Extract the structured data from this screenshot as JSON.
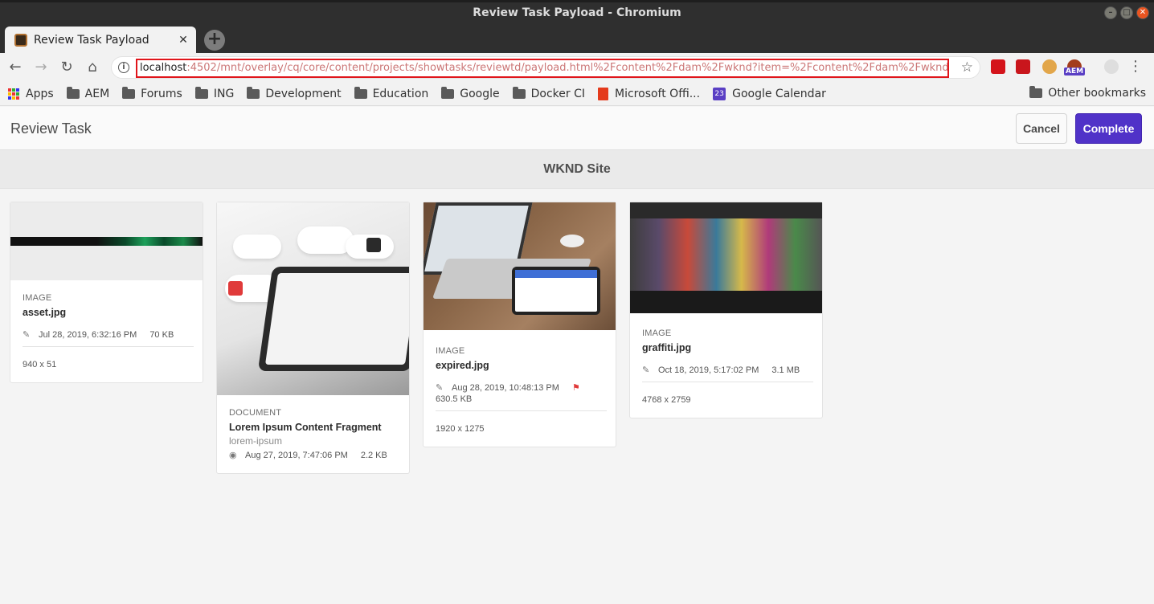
{
  "window": {
    "title": "Review Task Payload - Chromium"
  },
  "tab": {
    "title": "Review Task Payload",
    "close": "✕",
    "new_tab": "+"
  },
  "toolbar": {
    "url_host": "localhost",
    "url_rest": ":4502/mnt/overlay/cq/core/content/projects/showtasks/reviewtd/payload.html%2Fcontent%2Fdam%2Fwknd?item=%2Fcontent%2Fdam%2Fwknd%...",
    "info": "i",
    "star": "☆",
    "aem_badge": "AEM",
    "menu": "⋮"
  },
  "bookmarks": {
    "apps": "Apps",
    "items": [
      "AEM",
      "Forums",
      "ING",
      "Development",
      "Education",
      "Google",
      "Docker CI"
    ],
    "microsoft": "Microsoft Offi...",
    "calendar_number": "23",
    "calendar": "Google Calendar",
    "other": "Other bookmarks"
  },
  "header": {
    "title": "Review Task",
    "cancel_label": "Cancel",
    "complete_label": "Complete"
  },
  "site": {
    "title": "WKND Site"
  },
  "cards": [
    {
      "type": "IMAGE",
      "name": "asset.jpg",
      "date": "Jul 28, 2019, 6:32:16 PM",
      "size": "70 KB",
      "dims": "940 x 51"
    },
    {
      "type": "DOCUMENT",
      "name": "Lorem Ipsum Content Fragment",
      "sub": "lorem-ipsum",
      "date": "Aug 27, 2019, 7:47:06 PM",
      "size": "2.2 KB"
    },
    {
      "type": "IMAGE",
      "name": "expired.jpg",
      "date": "Aug 28, 2019, 10:48:13 PM",
      "size": "630.5 KB",
      "dims": "1920 x 1275"
    },
    {
      "type": "IMAGE",
      "name": "graffiti.jpg",
      "date": "Oct 18, 2019, 5:17:02 PM",
      "size": "3.1 MB",
      "dims": "4768 x 2759"
    }
  ],
  "colors": {
    "accent": "#5032c8",
    "url_highlight": "#e0151b"
  }
}
